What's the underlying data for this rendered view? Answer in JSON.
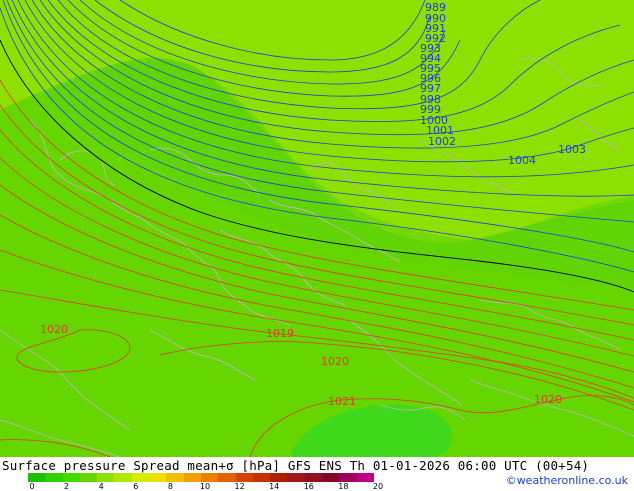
{
  "map": {
    "isobar_labels_blue": [
      "989",
      "990",
      "991",
      "992",
      "993",
      "994",
      "995",
      "996",
      "997",
      "998",
      "999",
      "1000",
      "1001",
      "1002",
      "1003",
      "1004"
    ],
    "isobar_labels_red": [
      "1020",
      "1019",
      "1020",
      "1021",
      "1020"
    ],
    "colors": {
      "base_green": "#66d600",
      "light_green": "#8ee000",
      "dark_green": "#3fd81a",
      "blue_isobar": "#1f3fdc",
      "red_isobar": "#e23a2c",
      "black_isobar": "#000000",
      "coast": "#b8b8b8"
    }
  },
  "footer": {
    "title": "Surface pressure Spread mean+σ [hPa] GFS ENS  Th 01-01-2026 06:00 UTC (00+54)",
    "credit": "©weatheronline.co.uk",
    "colorbar_colors": [
      "#1cc000",
      "#2dd200",
      "#44dc00",
      "#66d600",
      "#8ee000",
      "#b0e800",
      "#d4ec00",
      "#f0e000",
      "#f0c000",
      "#f0a000",
      "#ec8000",
      "#e46000",
      "#d84400",
      "#c83000",
      "#b02000",
      "#a01818",
      "#901020",
      "#800828",
      "#a00060",
      "#c00080"
    ],
    "colorbar_ticks": [
      "0",
      "2",
      "4",
      "6",
      "8",
      "10",
      "12",
      "14",
      "16",
      "18",
      "20"
    ]
  }
}
